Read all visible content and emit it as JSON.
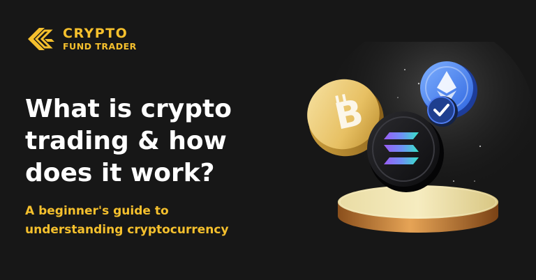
{
  "brand": {
    "name_line1": "CRYPTO",
    "name_line2": "FUND TRADER",
    "logo_icon": "cft-chevron-logo-icon"
  },
  "headline": {
    "line1": "What is crypto",
    "line2": "trading & how",
    "line3": "does it work?"
  },
  "subheadline": {
    "line1": "A beginner's guide to",
    "line2": "understanding cryptocurrency"
  },
  "illustration": {
    "coins": [
      "bitcoin-coin-icon",
      "solana-coin-icon",
      "ethereum-coin-icon"
    ],
    "badge": "verified-check-icon",
    "pedestal": "gold-pedestal"
  },
  "colors": {
    "background": "#171717",
    "accent": "#F5C02D",
    "headline": "#FFFFFF"
  }
}
